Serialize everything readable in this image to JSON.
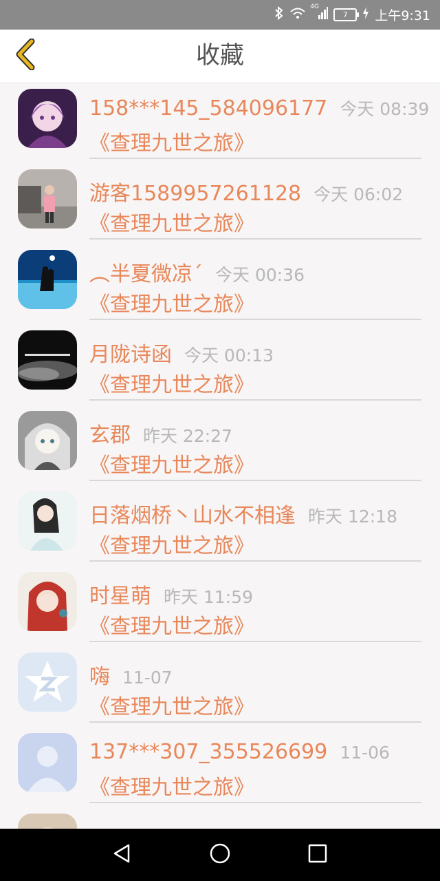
{
  "status_bar": {
    "network": "4G",
    "battery": "7",
    "time": "上午9:31"
  },
  "header": {
    "title": "收藏",
    "back_icon": "chevron-left-icon"
  },
  "colors": {
    "accent": "#e8875a",
    "back_icon": "#e8b820",
    "time_text": "#b8b8b8"
  },
  "items": [
    {
      "username": "158***145_584096177",
      "time": "今天 08:39",
      "book": "《查理九世之旅》"
    },
    {
      "username": "游客1589957261128",
      "time": "今天 06:02",
      "book": "《查理九世之旅》"
    },
    {
      "username": "︵半夏微凉´",
      "time": "今天 00:36",
      "book": "《查理九世之旅》"
    },
    {
      "username": "月陇诗函",
      "time": "今天 00:13",
      "book": "《查理九世之旅》"
    },
    {
      "username": "玄郡",
      "time": "昨天 22:27",
      "book": "《查理九世之旅》"
    },
    {
      "username": "日落烟桥丶山水不相逢",
      "time": "昨天 12:18",
      "book": "《查理九世之旅》"
    },
    {
      "username": "时星萌",
      "time": "昨天 11:59",
      "book": "《查理九世之旅》"
    },
    {
      "username": "嗨",
      "time": "11-07",
      "book": "《查理九世之旅》"
    },
    {
      "username": "137***307_355526699",
      "time": "11-06",
      "book": "《查理九世之旅》"
    }
  ]
}
